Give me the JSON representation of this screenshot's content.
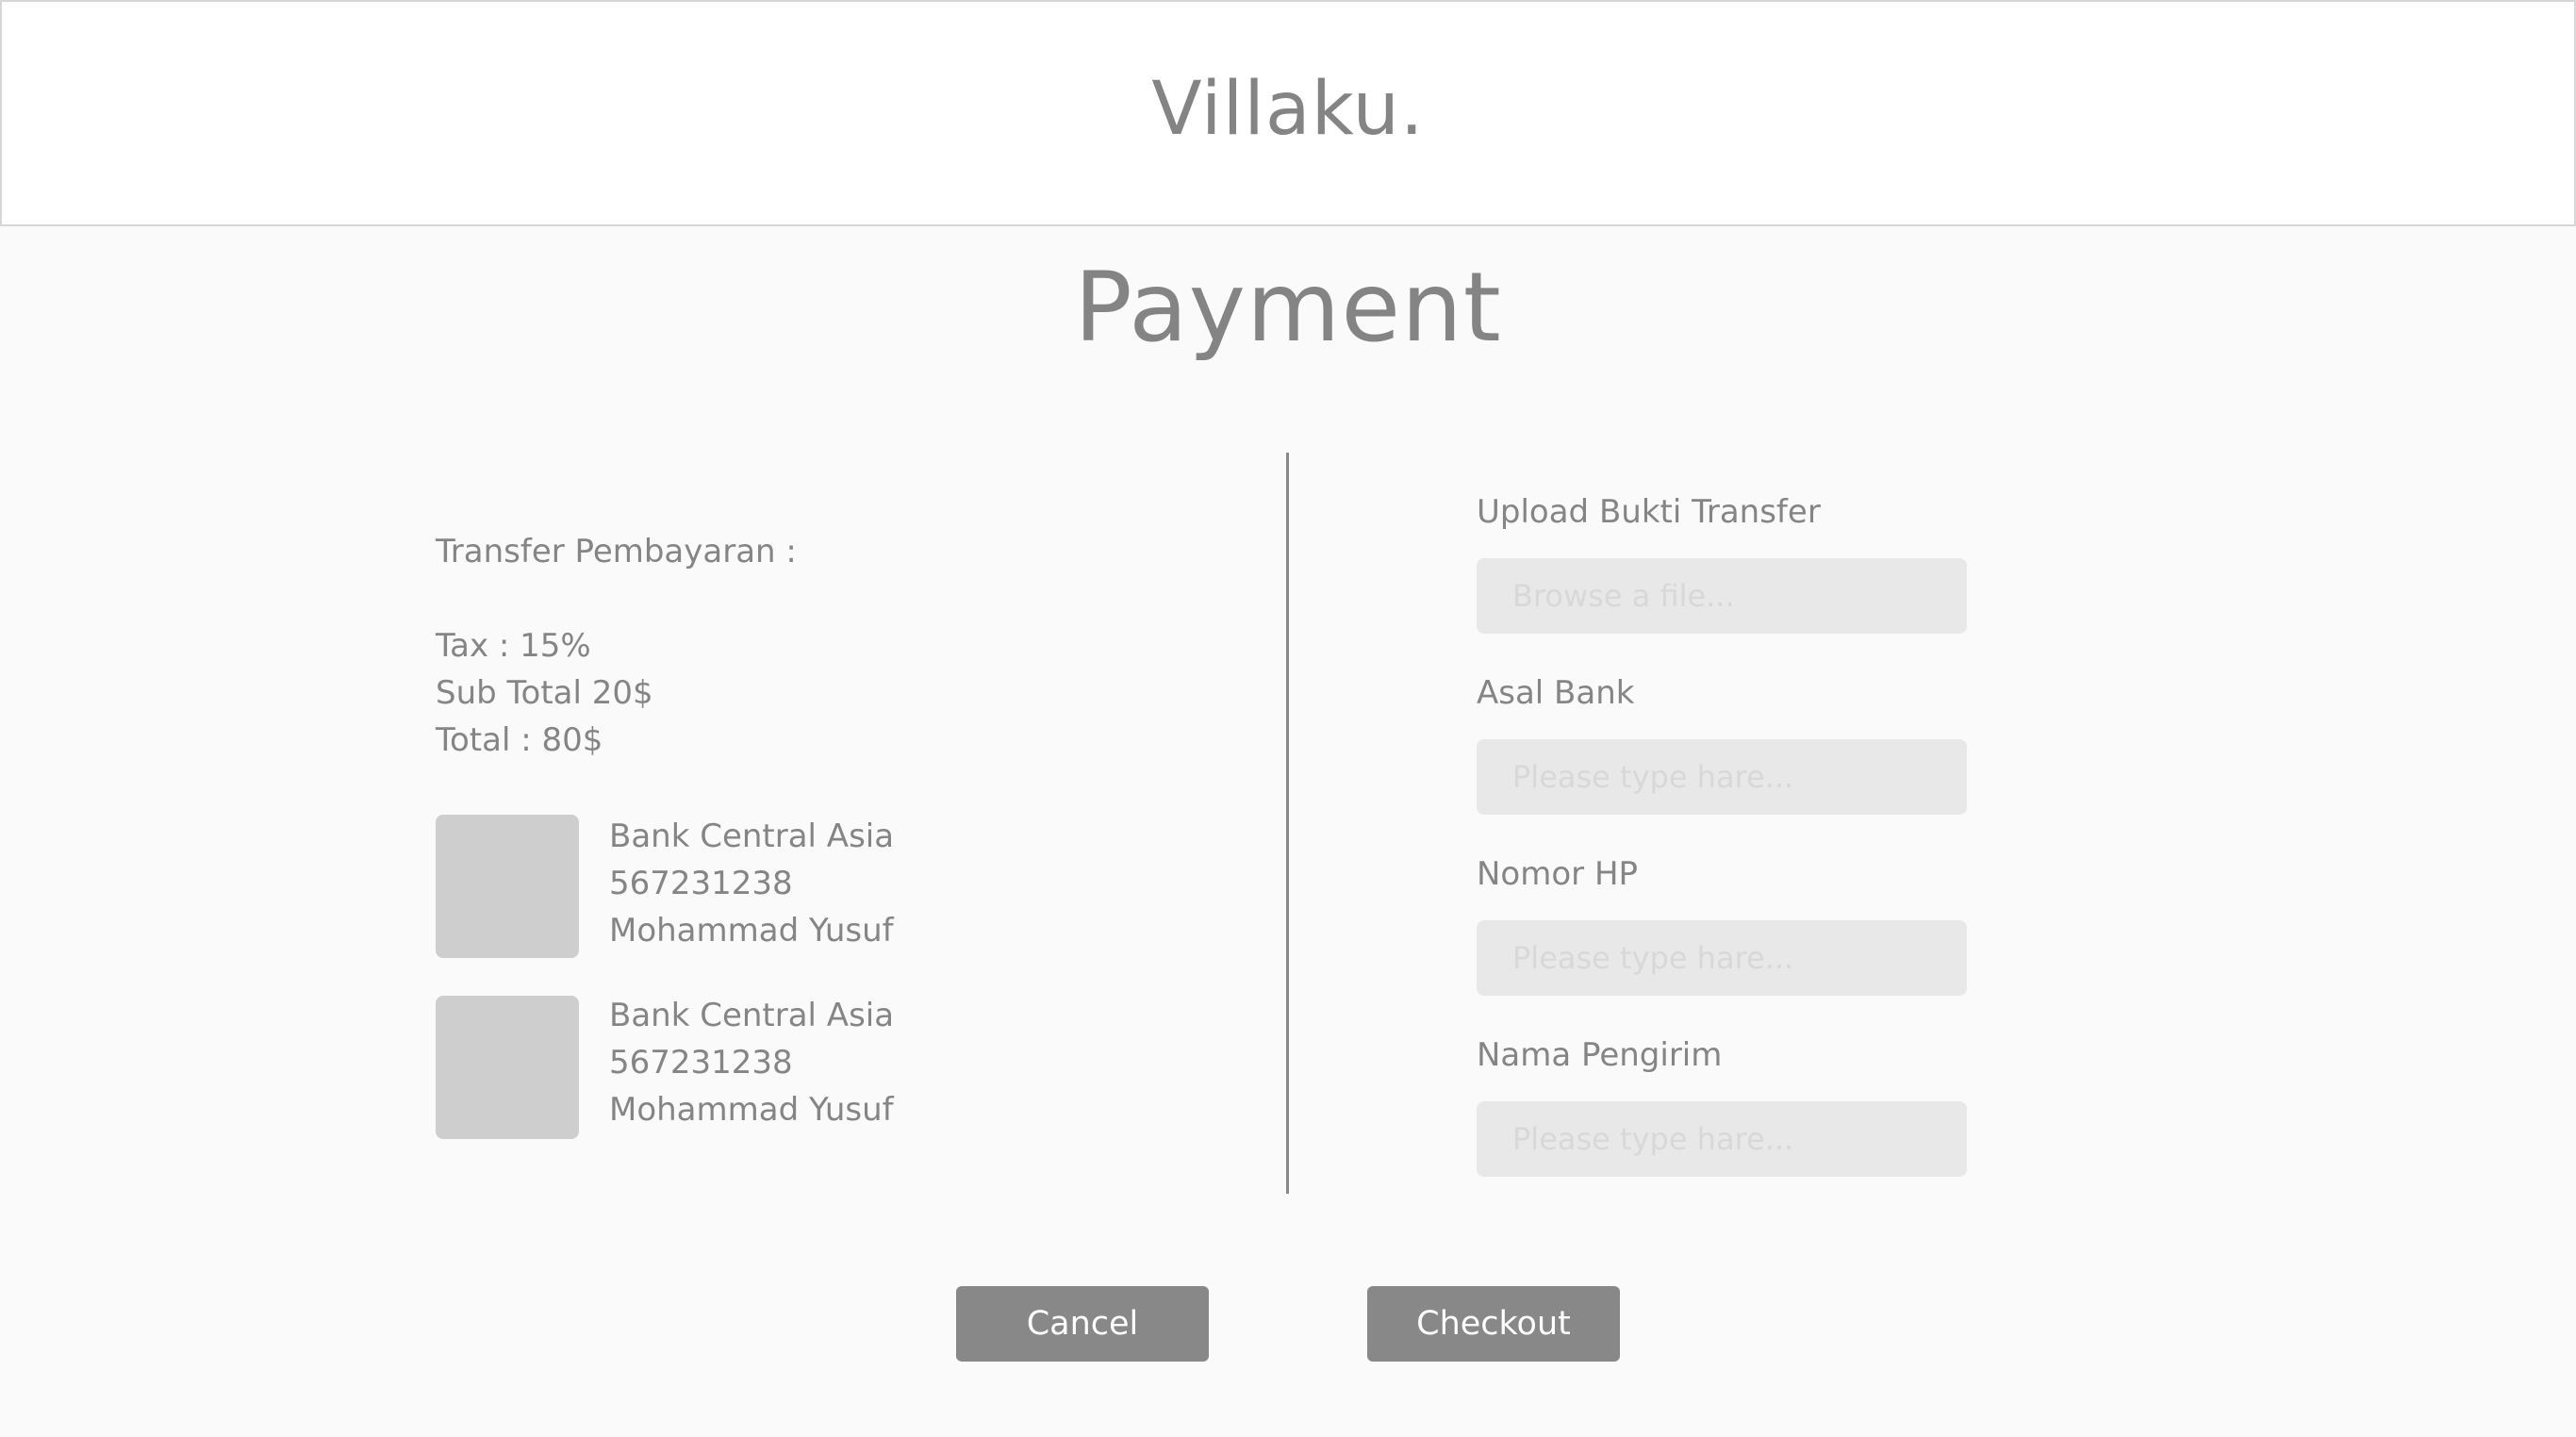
{
  "header": {
    "brand": "Villaku."
  },
  "page": {
    "title": "Payment"
  },
  "summary": {
    "transfer_label": "Transfer Pembayaran :",
    "tax": "Tax : 15%",
    "sub_total": "Sub Total 20$",
    "total": "Total : 80$"
  },
  "banks": [
    {
      "name": "Bank Central Asia",
      "account_number": "567231238",
      "holder": "Mohammad Yusuf"
    },
    {
      "name": "Bank Central Asia",
      "account_number": "567231238",
      "holder": "Mohammad Yusuf"
    }
  ],
  "form": {
    "upload": {
      "label": "Upload Bukti Transfer",
      "placeholder": "Browse a file..."
    },
    "bank_origin": {
      "label": "Asal Bank",
      "placeholder": "Please type hare..."
    },
    "phone": {
      "label": "Nomor HP",
      "placeholder": "Please type hare..."
    },
    "sender": {
      "label": "Nama Pengirim",
      "placeholder": "Please type hare..."
    }
  },
  "actions": {
    "cancel_label": "Cancel",
    "checkout_label": "Checkout"
  },
  "colors": {
    "background": "#fafafa",
    "header_background": "#ffffff",
    "text": "#858585",
    "button": "#888888",
    "input": "#e8e8e8",
    "bank_logo": "#cecece"
  }
}
